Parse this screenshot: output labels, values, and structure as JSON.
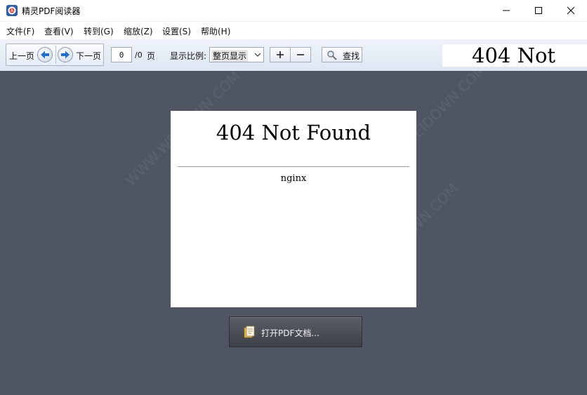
{
  "window": {
    "title": "精灵PDF阅读器",
    "app_icon": "app-logo-icon",
    "controls": [
      "minimize-icon",
      "maximize-icon",
      "close-icon"
    ]
  },
  "menu": [
    {
      "label": "文件(F)"
    },
    {
      "label": "查看(V)"
    },
    {
      "label": "转到(G)"
    },
    {
      "label": "缩放(Z)"
    },
    {
      "label": "设置(S)"
    },
    {
      "label": "帮助(H)"
    }
  ],
  "toolbar": {
    "prev_label": "上一页",
    "next_label": "下一页",
    "page_value": "0",
    "page_total": "/0",
    "page_unit": "页",
    "zoom_label": "显示比例:",
    "zoom_value": "整页显示",
    "find_label": "查找",
    "search_text": "404 Not"
  },
  "document": {
    "heading": "404 Not Found",
    "subtext": "nginx",
    "open_button": "打开PDF文档..."
  },
  "watermark": "WWW.WEIDOWN.COM",
  "colors": {
    "workspace": "#4f5563",
    "toolbar": "#e4ebf5",
    "arrow_blue": "#1e6fd0"
  }
}
